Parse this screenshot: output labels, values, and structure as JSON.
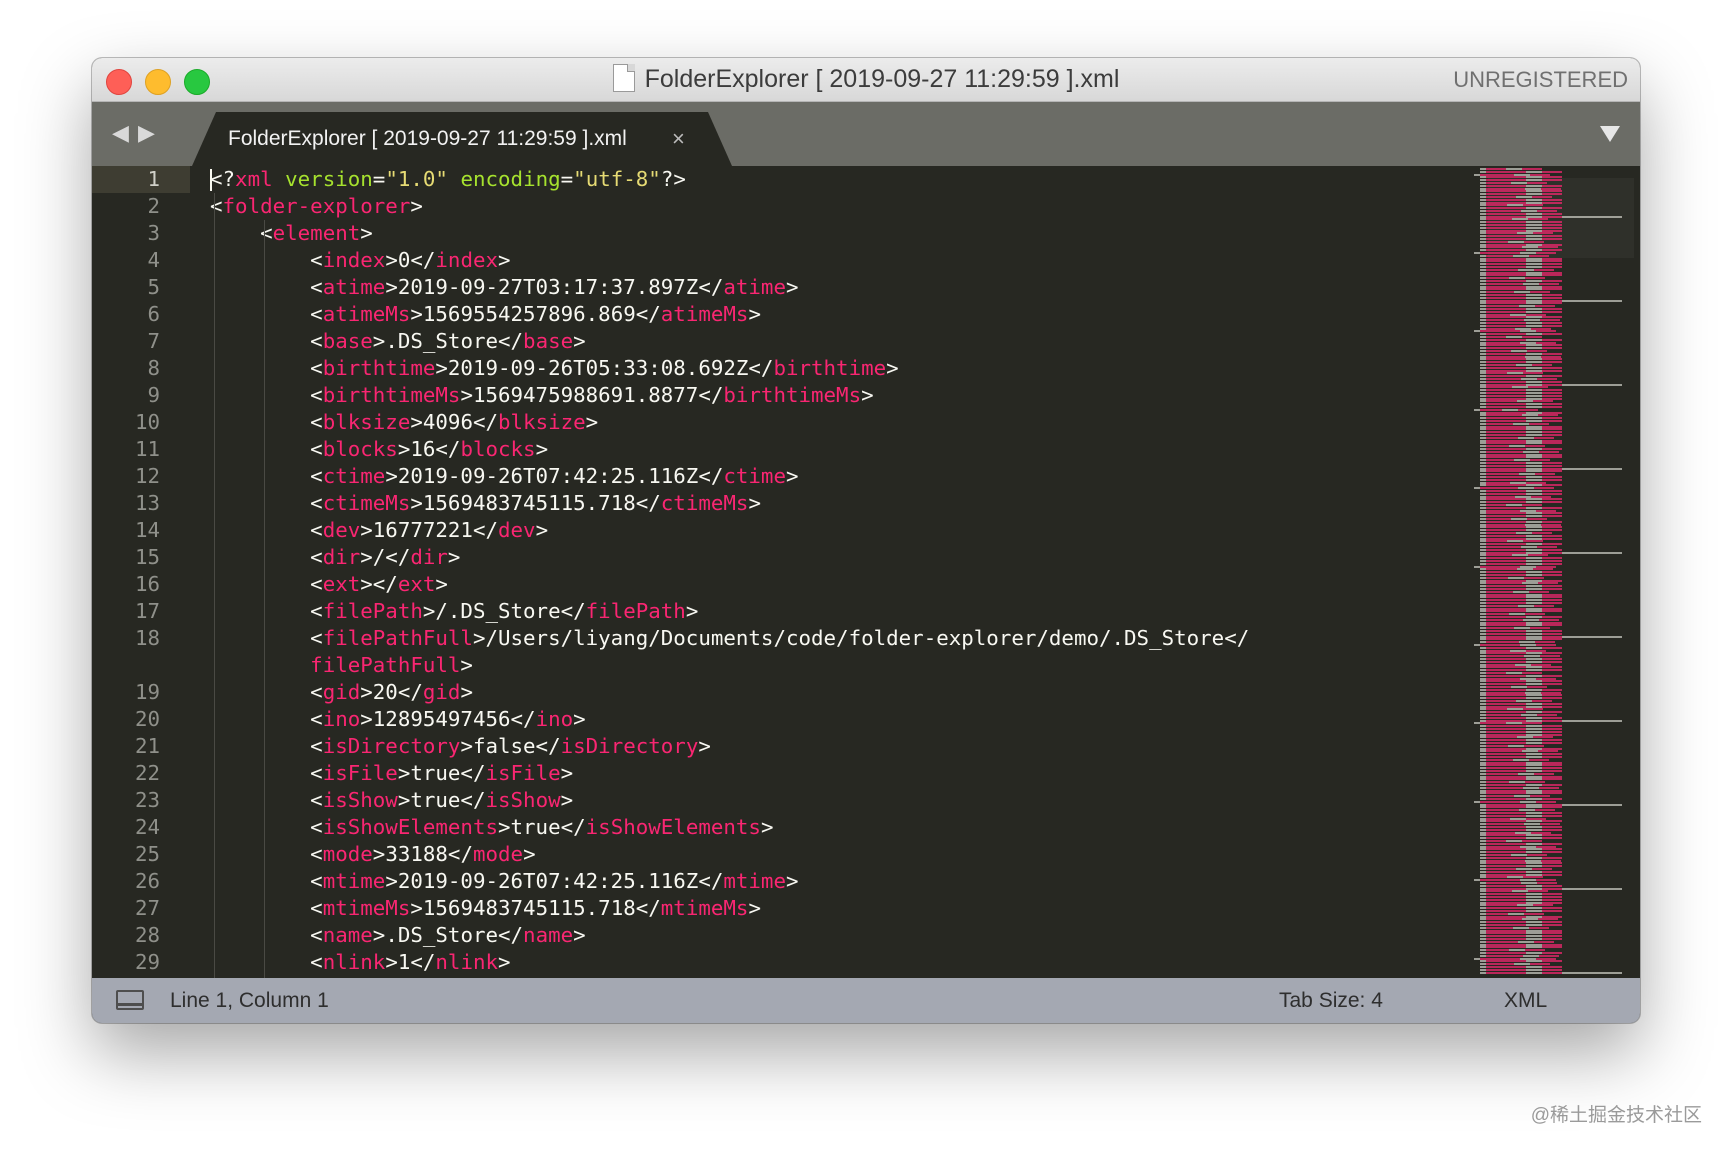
{
  "window": {
    "title": "FolderExplorer [ 2019-09-27 11:29:59 ].xml",
    "registration": "UNREGISTERED"
  },
  "tabs": [
    {
      "label": "FolderExplorer [ 2019-09-27 11:29:59 ].xml",
      "close": "×"
    }
  ],
  "nav": {
    "back": "◀",
    "forward": "▶"
  },
  "editor": {
    "line_numbers": [
      "1",
      "2",
      "3",
      "4",
      "5",
      "6",
      "7",
      "8",
      "9",
      "10",
      "11",
      "12",
      "13",
      "14",
      "15",
      "16",
      "17",
      "18",
      "",
      "19",
      "20",
      "21",
      "22",
      "23",
      "24",
      "25",
      "26",
      "27",
      "28",
      "29"
    ],
    "active_line": 1,
    "lines": [
      {
        "indent": 0,
        "tokens": [
          [
            "p",
            "<?"
          ],
          [
            "t",
            "xml"
          ],
          [
            "p",
            " "
          ],
          [
            "a",
            "version"
          ],
          [
            "p",
            "="
          ],
          [
            "s",
            "\"1.0\""
          ],
          [
            "p",
            " "
          ],
          [
            "a",
            "encoding"
          ],
          [
            "p",
            "="
          ],
          [
            "s",
            "\"utf-8\""
          ],
          [
            "p",
            "?>"
          ]
        ]
      },
      {
        "indent": 0,
        "tokens": [
          [
            "p",
            "<"
          ],
          [
            "t",
            "folder-explorer"
          ],
          [
            "p",
            ">"
          ]
        ]
      },
      {
        "indent": 1,
        "tokens": [
          [
            "p",
            "<"
          ],
          [
            "t",
            "element"
          ],
          [
            "p",
            ">"
          ]
        ]
      },
      {
        "indent": 2,
        "tokens": [
          [
            "p",
            "<"
          ],
          [
            "t",
            "index"
          ],
          [
            "p",
            ">0</"
          ],
          [
            "t",
            "index"
          ],
          [
            "p",
            ">"
          ]
        ]
      },
      {
        "indent": 2,
        "tokens": [
          [
            "p",
            "<"
          ],
          [
            "t",
            "atime"
          ],
          [
            "p",
            ">2019-09-27T03:17:37.897Z</"
          ],
          [
            "t",
            "atime"
          ],
          [
            "p",
            ">"
          ]
        ]
      },
      {
        "indent": 2,
        "tokens": [
          [
            "p",
            "<"
          ],
          [
            "t",
            "atimeMs"
          ],
          [
            "p",
            ">1569554257896.869</"
          ],
          [
            "t",
            "atimeMs"
          ],
          [
            "p",
            ">"
          ]
        ]
      },
      {
        "indent": 2,
        "tokens": [
          [
            "p",
            "<"
          ],
          [
            "t",
            "base"
          ],
          [
            "p",
            ">.DS_Store</"
          ],
          [
            "t",
            "base"
          ],
          [
            "p",
            ">"
          ]
        ]
      },
      {
        "indent": 2,
        "tokens": [
          [
            "p",
            "<"
          ],
          [
            "t",
            "birthtime"
          ],
          [
            "p",
            ">2019-09-26T05:33:08.692Z</"
          ],
          [
            "t",
            "birthtime"
          ],
          [
            "p",
            ">"
          ]
        ]
      },
      {
        "indent": 2,
        "tokens": [
          [
            "p",
            "<"
          ],
          [
            "t",
            "birthtimeMs"
          ],
          [
            "p",
            ">1569475988691.8877</"
          ],
          [
            "t",
            "birthtimeMs"
          ],
          [
            "p",
            ">"
          ]
        ]
      },
      {
        "indent": 2,
        "tokens": [
          [
            "p",
            "<"
          ],
          [
            "t",
            "blksize"
          ],
          [
            "p",
            ">4096</"
          ],
          [
            "t",
            "blksize"
          ],
          [
            "p",
            ">"
          ]
        ]
      },
      {
        "indent": 2,
        "tokens": [
          [
            "p",
            "<"
          ],
          [
            "t",
            "blocks"
          ],
          [
            "p",
            ">16</"
          ],
          [
            "t",
            "blocks"
          ],
          [
            "p",
            ">"
          ]
        ]
      },
      {
        "indent": 2,
        "tokens": [
          [
            "p",
            "<"
          ],
          [
            "t",
            "ctime"
          ],
          [
            "p",
            ">2019-09-26T07:42:25.116Z</"
          ],
          [
            "t",
            "ctime"
          ],
          [
            "p",
            ">"
          ]
        ]
      },
      {
        "indent": 2,
        "tokens": [
          [
            "p",
            "<"
          ],
          [
            "t",
            "ctimeMs"
          ],
          [
            "p",
            ">1569483745115.718</"
          ],
          [
            "t",
            "ctimeMs"
          ],
          [
            "p",
            ">"
          ]
        ]
      },
      {
        "indent": 2,
        "tokens": [
          [
            "p",
            "<"
          ],
          [
            "t",
            "dev"
          ],
          [
            "p",
            ">16777221</"
          ],
          [
            "t",
            "dev"
          ],
          [
            "p",
            ">"
          ]
        ]
      },
      {
        "indent": 2,
        "tokens": [
          [
            "p",
            "<"
          ],
          [
            "t",
            "dir"
          ],
          [
            "p",
            ">/</"
          ],
          [
            "t",
            "dir"
          ],
          [
            "p",
            ">"
          ]
        ]
      },
      {
        "indent": 2,
        "tokens": [
          [
            "p",
            "<"
          ],
          [
            "t",
            "ext"
          ],
          [
            "p",
            "></"
          ],
          [
            "t",
            "ext"
          ],
          [
            "p",
            ">"
          ]
        ]
      },
      {
        "indent": 2,
        "tokens": [
          [
            "p",
            "<"
          ],
          [
            "t",
            "filePath"
          ],
          [
            "p",
            ">/.DS_Store</"
          ],
          [
            "t",
            "filePath"
          ],
          [
            "p",
            ">"
          ]
        ]
      },
      {
        "indent": 2,
        "tokens": [
          [
            "p",
            "<"
          ],
          [
            "t",
            "filePathFull"
          ],
          [
            "p",
            ">/Users/liyang/Documents/code/folder-explorer/demo/.DS_Store</"
          ]
        ]
      },
      {
        "indent": 2,
        "tokens": [
          [
            "t",
            "filePathFull"
          ],
          [
            "p",
            ">"
          ]
        ]
      },
      {
        "indent": 2,
        "tokens": [
          [
            "p",
            "<"
          ],
          [
            "t",
            "gid"
          ],
          [
            "p",
            ">20</"
          ],
          [
            "t",
            "gid"
          ],
          [
            "p",
            ">"
          ]
        ]
      },
      {
        "indent": 2,
        "tokens": [
          [
            "p",
            "<"
          ],
          [
            "t",
            "ino"
          ],
          [
            "p",
            ">12895497456</"
          ],
          [
            "t",
            "ino"
          ],
          [
            "p",
            ">"
          ]
        ]
      },
      {
        "indent": 2,
        "tokens": [
          [
            "p",
            "<"
          ],
          [
            "t",
            "isDirectory"
          ],
          [
            "p",
            ">false</"
          ],
          [
            "t",
            "isDirectory"
          ],
          [
            "p",
            ">"
          ]
        ]
      },
      {
        "indent": 2,
        "tokens": [
          [
            "p",
            "<"
          ],
          [
            "t",
            "isFile"
          ],
          [
            "p",
            ">true</"
          ],
          [
            "t",
            "isFile"
          ],
          [
            "p",
            ">"
          ]
        ]
      },
      {
        "indent": 2,
        "tokens": [
          [
            "p",
            "<"
          ],
          [
            "t",
            "isShow"
          ],
          [
            "p",
            ">true</"
          ],
          [
            "t",
            "isShow"
          ],
          [
            "p",
            ">"
          ]
        ]
      },
      {
        "indent": 2,
        "tokens": [
          [
            "p",
            "<"
          ],
          [
            "t",
            "isShowElements"
          ],
          [
            "p",
            ">true</"
          ],
          [
            "t",
            "isShowElements"
          ],
          [
            "p",
            ">"
          ]
        ]
      },
      {
        "indent": 2,
        "tokens": [
          [
            "p",
            "<"
          ],
          [
            "t",
            "mode"
          ],
          [
            "p",
            ">33188</"
          ],
          [
            "t",
            "mode"
          ],
          [
            "p",
            ">"
          ]
        ]
      },
      {
        "indent": 2,
        "tokens": [
          [
            "p",
            "<"
          ],
          [
            "t",
            "mtime"
          ],
          [
            "p",
            ">2019-09-26T07:42:25.116Z</"
          ],
          [
            "t",
            "mtime"
          ],
          [
            "p",
            ">"
          ]
        ]
      },
      {
        "indent": 2,
        "tokens": [
          [
            "p",
            "<"
          ],
          [
            "t",
            "mtimeMs"
          ],
          [
            "p",
            ">1569483745115.718</"
          ],
          [
            "t",
            "mtimeMs"
          ],
          [
            "p",
            ">"
          ]
        ]
      },
      {
        "indent": 2,
        "tokens": [
          [
            "p",
            "<"
          ],
          [
            "t",
            "name"
          ],
          [
            "p",
            ">.DS_Store</"
          ],
          [
            "t",
            "name"
          ],
          [
            "p",
            ">"
          ]
        ]
      },
      {
        "indent": 2,
        "tokens": [
          [
            "p",
            "<"
          ],
          [
            "t",
            "nlink"
          ],
          [
            "p",
            ">1</"
          ],
          [
            "t",
            "nlink"
          ],
          [
            "p",
            ">"
          ]
        ]
      }
    ]
  },
  "statusbar": {
    "position": "Line 1, Column 1",
    "tab_size": "Tab Size: 4",
    "syntax": "XML"
  },
  "watermark": "@稀土掘金技术社区",
  "colors": {
    "background": "#272822",
    "tag": "#f92672",
    "attribute": "#a6e22e",
    "string": "#e6db74",
    "text": "#f8f8f2"
  }
}
